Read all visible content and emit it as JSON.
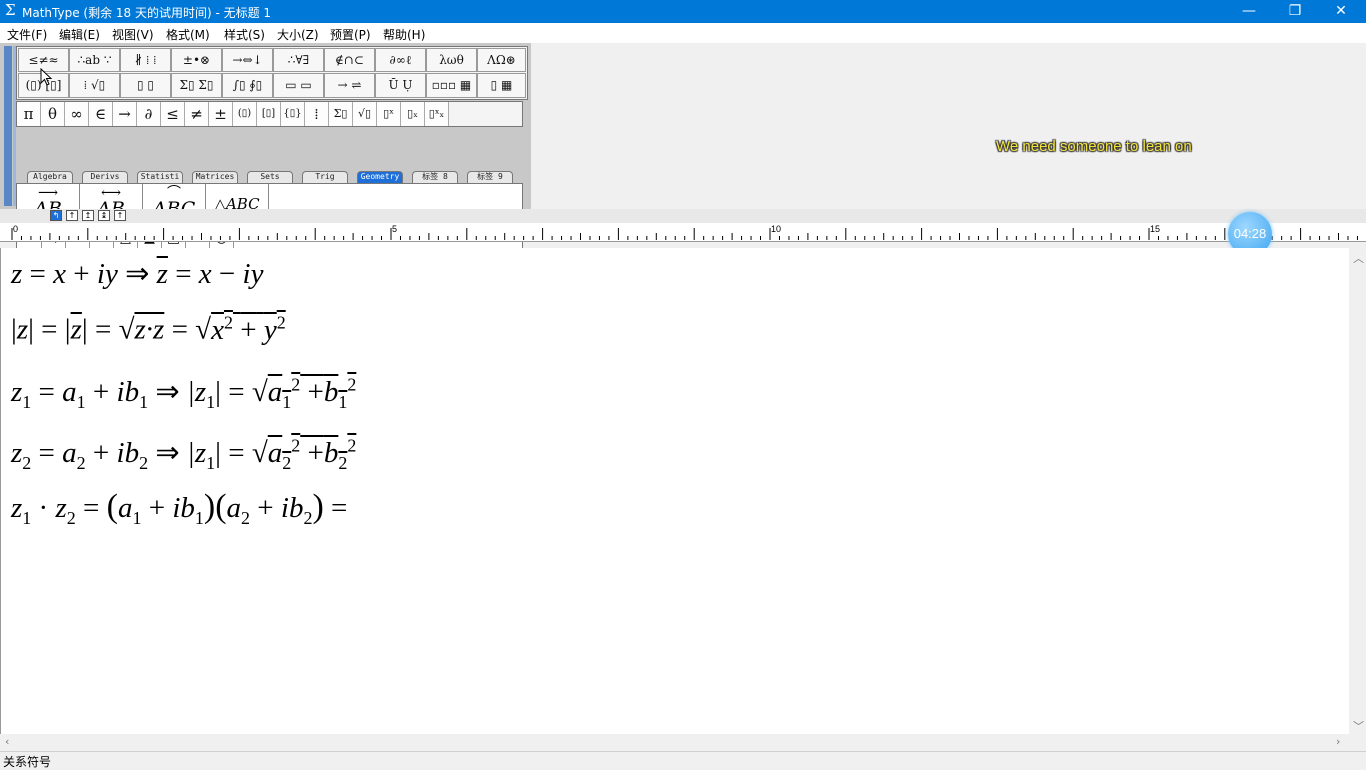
{
  "window": {
    "title": "MathType (剩余 18 天的试用时间) - 无标题 1",
    "app_icon": "Σ",
    "minimize": "—",
    "maximize": "❐",
    "close": "✕"
  },
  "menu": [
    "文件(F)",
    "编辑(E)",
    "视图(V)",
    "格式(M)",
    "样式(S)",
    "大小(Z)",
    "预置(P)",
    "帮助(H)"
  ],
  "palette_row1": [
    "≤≠≈",
    "∴ab ∵",
    "∦ ⁞ ⁞",
    "±•⊗",
    "→⇔↓",
    "∴∀∃",
    "∉∩⊂",
    "∂∞ℓ",
    "λωθ",
    "ΛΩ⊛"
  ],
  "palette_row2": [
    "(▯) [▯]",
    "⁞ √▯",
    "▯ ▯",
    "Σ▯ Σ▯",
    "∫▯ ∮▯",
    "▭ ▭",
    "→ ⇌",
    "Ū Ụ",
    "▫▫▫ ▦",
    "▯ ▦"
  ],
  "symbol_bar": [
    "π",
    "θ",
    "∞",
    "∈",
    "→",
    "∂",
    "≤",
    "≠",
    "±",
    "(▯)",
    "[▯]",
    "{▯}",
    "⁞",
    "Σ▯",
    "√▯",
    "▯ˣ",
    "▯ₓ",
    "▯ˣₓ"
  ],
  "tabs": [
    "Algebra",
    "Derivs",
    "Statisti",
    "Matrices",
    "Sets",
    "Trig",
    "Geometry",
    "标签 8",
    "标签 9"
  ],
  "active_tab": "Geometry",
  "templates": [
    "AB",
    "AB",
    "ABC",
    "△ABC"
  ],
  "geometry_symbols": [
    "∠",
    "∡",
    "∢",
    "⊥",
    "△",
    "▲",
    "□",
    "▱",
    "○"
  ],
  "subtitle": "We need someone to lean on",
  "timer": "04:28",
  "ruler": {
    "labels": [
      "0",
      "5",
      "10",
      "15"
    ]
  },
  "tab_stops": [
    "↰",
    "↑",
    "↥",
    "↨",
    "↑"
  ],
  "equations": {
    "e1": {
      "a": "z",
      "b": "=",
      "c": "x",
      "d": "+",
      "e": "iy",
      "f": "⇒",
      "g": "z",
      "h": "=",
      "i": "x",
      "j": "−",
      "k": "iy"
    },
    "e2": {
      "a": "|",
      "b": "z",
      "c": "|",
      "d": "=",
      "e": "|",
      "f": "z",
      "g": "|",
      "h": "=",
      "i": "√",
      "j": "z·z",
      "k": "=",
      "l": "√",
      "m": "x",
      "n": "2",
      "o": "+",
      "p": "y",
      "q": "2"
    },
    "e3": {
      "a": "z",
      "a1": "1",
      "b": "=",
      "c": "a",
      "c1": "1",
      "d": "+",
      "e": "ib",
      "e1": "1",
      "f": "⇒",
      "g": "|z",
      "g1": "1",
      "g2": "|",
      "h": "=",
      "i": "√",
      "j": "a",
      "j1": "1",
      "j2": "2",
      "k": "+",
      "l": "b",
      "l1": "1",
      "l2": "2"
    },
    "e4": {
      "a": "z",
      "a1": "2",
      "b": "=",
      "c": "a",
      "c1": "2",
      "d": "+",
      "e": "ib",
      "e1": "2",
      "f": "⇒",
      "g": "|z",
      "g1": "1",
      "g2": "|",
      "h": "=",
      "i": "√",
      "j": "a",
      "j1": "2",
      "j2": "2",
      "k": "+",
      "l": "b",
      "l1": "2",
      "l2": "2"
    },
    "e5": {
      "a": "z",
      "a1": "1",
      "b": "·",
      "c": "z",
      "c1": "2",
      "d": "=",
      "e": "(",
      "f": "a",
      "f1": "1",
      "g": "+",
      "h": "ib",
      "h1": "1",
      "i": ")",
      "j": "(",
      "k": "a",
      "k1": "2",
      "l": "+",
      "m": "ib",
      "m1": "2",
      "n": ")",
      "o": "="
    }
  },
  "status": "关系符号"
}
